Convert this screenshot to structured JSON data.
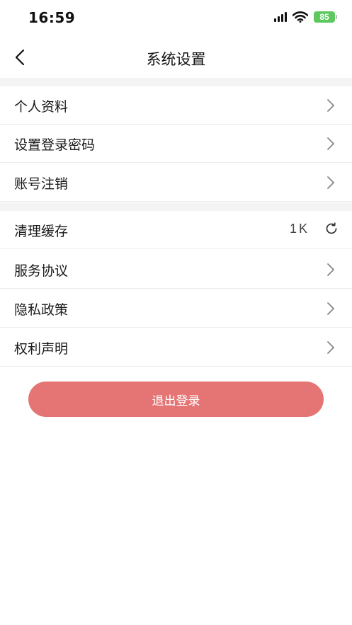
{
  "status_bar": {
    "time": "16:59",
    "battery": "85",
    "icons": [
      "signal-icon",
      "wifi-icon",
      "battery-icon"
    ]
  },
  "nav": {
    "title": "系统设置",
    "back_icon": "chevron-left-icon"
  },
  "group_one": [
    {
      "label": "个人资料",
      "icon": "chevron-right-icon"
    },
    {
      "label": "设置登录密码",
      "icon": "chevron-right-icon"
    },
    {
      "label": "账号注销",
      "icon": "chevron-right-icon"
    }
  ],
  "group_two": {
    "cache": {
      "label": "清理缓存",
      "value": "1K",
      "icon": "refresh-icon"
    },
    "items": [
      {
        "label": "服务协议",
        "icon": "chevron-right-icon"
      },
      {
        "label": "隐私政策",
        "icon": "chevron-right-icon"
      },
      {
        "label": "权利声明",
        "icon": "chevron-right-icon"
      }
    ]
  },
  "logout": {
    "label": "退出登录"
  },
  "colors": {
    "accent": "#e57574",
    "battery": "#5cc85d",
    "section_gap": "#f4f4f4",
    "divider": "#ececec"
  }
}
